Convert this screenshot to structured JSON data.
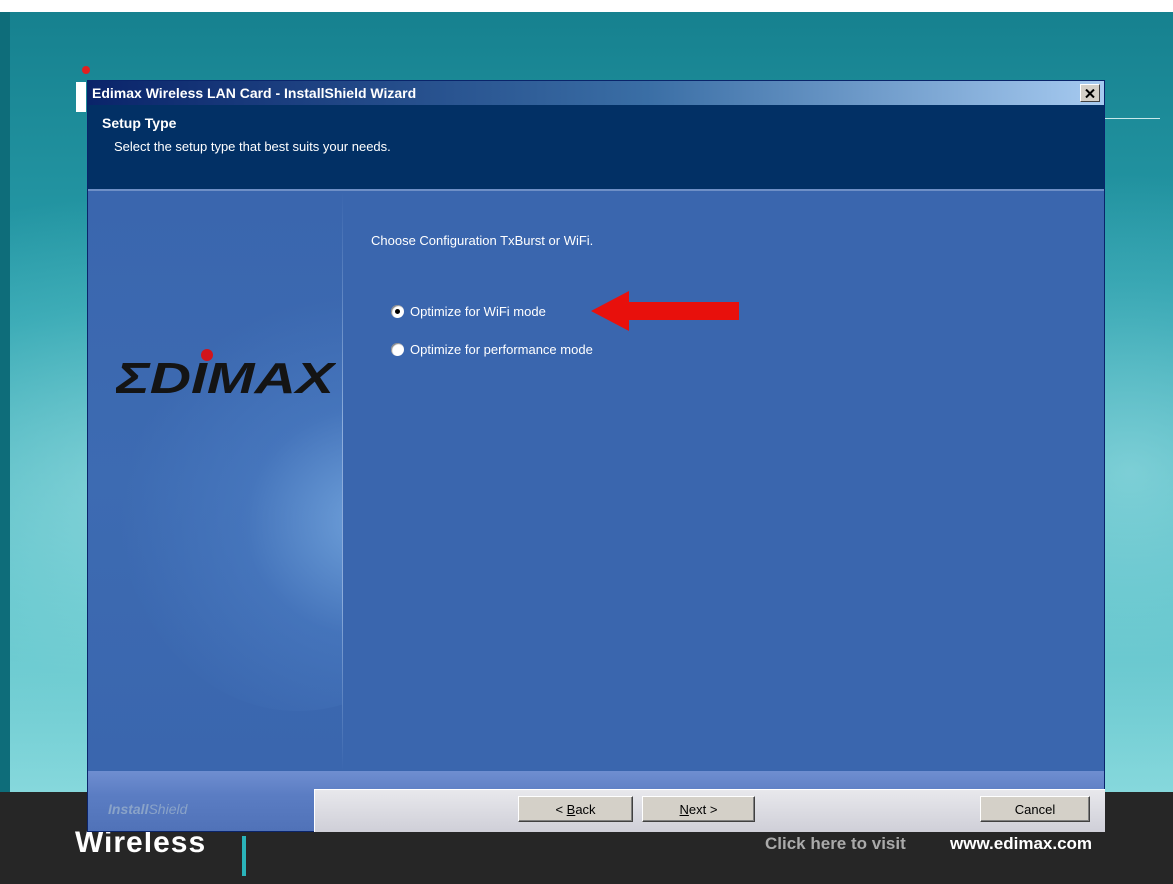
{
  "window": {
    "title": "Edimax Wireless LAN Card - InstallShield Wizard",
    "close_label": "X"
  },
  "header": {
    "title": "Setup Type",
    "subtitle": "Select the setup type that best suits your needs."
  },
  "sidebar": {
    "logo_text": "EDIMAX"
  },
  "content": {
    "prompt": "Choose Configuration TxBurst or WiFi.",
    "options": [
      {
        "label": "Optimize for WiFi mode",
        "selected": true
      },
      {
        "label": "Optimize for performance mode",
        "selected": false
      }
    ]
  },
  "footer": {
    "brand_bold": "Install",
    "brand_thin": "Shield",
    "back_prefix": "< ",
    "back_mnemonic": "B",
    "back_rest": "ack",
    "next_mnemonic": "N",
    "next_rest": "ext >",
    "cancel_label": "Cancel"
  },
  "background": {
    "wireless_text": "Wireless",
    "click_text": "Click here to visit",
    "url_text": "www.edimax.com"
  },
  "colors": {
    "dialog_blue": "#3a66ae",
    "header_navy": "#023065",
    "arrow_red": "#e8100c"
  }
}
